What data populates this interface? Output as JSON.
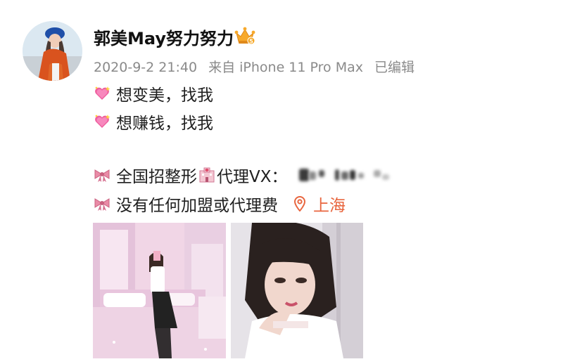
{
  "user": {
    "name": "郭美May努力努力",
    "badge_icon": "crown-badge-icon"
  },
  "meta": {
    "datetime": "2020-9-2 21:40",
    "source": "来自 iPhone 11 Pro Max",
    "edited": "已编辑"
  },
  "post": {
    "line1": "想变美，找我",
    "line2": "想赚钱，找我",
    "line3": "全国招整形",
    "line3_suffix": "代理VX：",
    "line4": "没有任何加盟或代理费",
    "location": "上海",
    "icons": {
      "heart": "sparkling-heart-icon",
      "ribbon": "ribbon-bow-icon",
      "hospital": "hospital-icon",
      "location": "location-pin-icon"
    }
  },
  "colors": {
    "name": "#111111",
    "meta": "#8a8a8a",
    "location": "#e8663f",
    "heart": "#ef5f9f",
    "ribbon": "#e98aa6"
  }
}
